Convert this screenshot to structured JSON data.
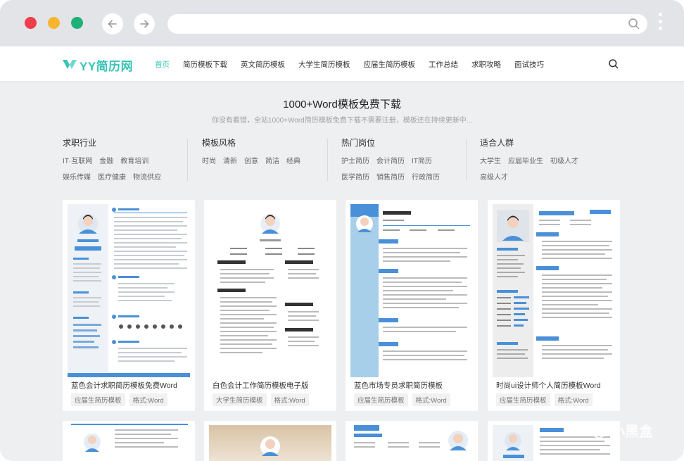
{
  "site": {
    "logo_text": "YY简历网",
    "nav": [
      "首页",
      "简历模板下载",
      "英文简历模板",
      "大学生简历模板",
      "应届生简历模板",
      "工作总结",
      "求职攻略",
      "面试技巧"
    ]
  },
  "hero": {
    "title": "1000+Word模板免费下载",
    "subtitle": "你没有看错，全站1000+Word简历模板免费下载不需要注册，模板还在持续更新中..."
  },
  "filters": [
    {
      "title": "求职行业",
      "rows": [
        [
          "IT·互联网",
          "金融",
          "教育培训"
        ],
        [
          "娱乐传媒",
          "医疗健康",
          "物流供应"
        ]
      ]
    },
    {
      "title": "模板风格",
      "rows": [
        [
          "时尚",
          "清新",
          "创意",
          "简洁",
          "经典"
        ]
      ]
    },
    {
      "title": "热门岗位",
      "rows": [
        [
          "护士简历",
          "会计简历",
          "IT简历"
        ],
        [
          "医学简历",
          "销售简历",
          "行政简历"
        ]
      ]
    },
    {
      "title": "适合人群",
      "rows": [
        [
          "大学生",
          "应届毕业生",
          "初级人才"
        ],
        [
          "高级人才"
        ]
      ]
    }
  ],
  "cards": [
    {
      "title": "蓝色会计求职简历模板免费Word",
      "tags": [
        "应届生简历模板",
        "格式:Word"
      ]
    },
    {
      "title": "白色会计工作简历模板电子版",
      "tags": [
        "大学生简历模板",
        "格式:Word"
      ]
    },
    {
      "title": "蓝色市场专员求职简历模板",
      "tags": [
        "应届生简历模板",
        "格式:Word"
      ]
    },
    {
      "title": "时尚ui设计师个人简历模板Word",
      "tags": [
        "应届生简历模板",
        "格式:Word"
      ]
    }
  ],
  "watermark": "小黑盒",
  "colors": {
    "brand": "#38c3b6",
    "resume_blue": "#4a90d9"
  }
}
